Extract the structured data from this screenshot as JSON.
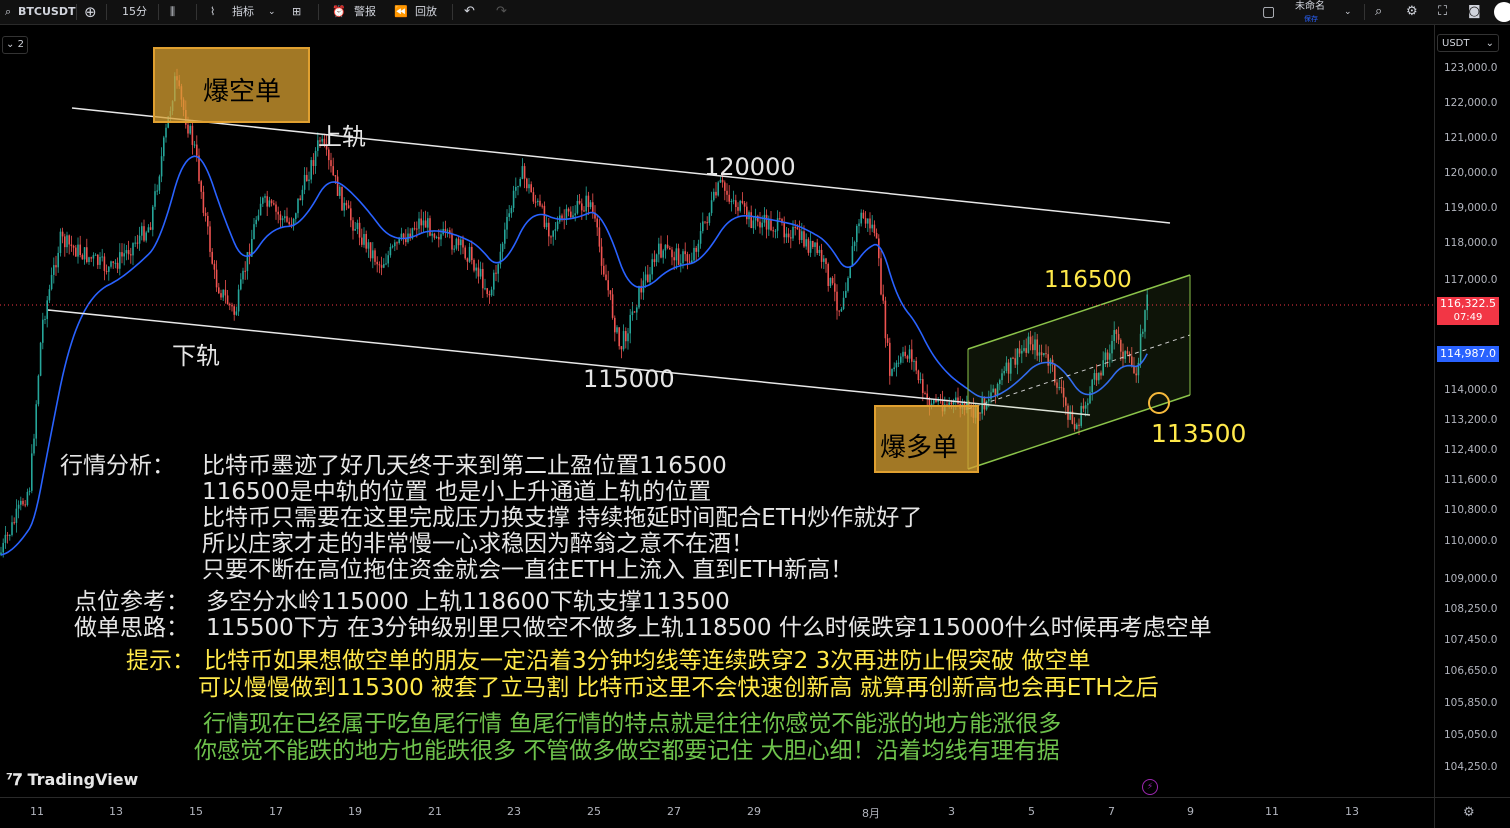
{
  "toolbar": {
    "symbol": "BTCUSDT",
    "interval": "15分",
    "indicators": "指标",
    "alerts": "警报",
    "replay": "回放",
    "layout_name": "未命名",
    "layout_status": "保存",
    "icons": [
      "search-icon",
      "plus-circle-icon",
      "candles-icon",
      "indicators-icon",
      "templates-icon",
      "alert-icon",
      "replay-icon",
      "undo-icon",
      "redo-icon",
      "fullscreen-icon",
      "camera-icon"
    ]
  },
  "legend": {
    "collapse": "2"
  },
  "currency": "USDT",
  "price_axis": [
    "123,000.0",
    "122,000.0",
    "121,000.0",
    "120,000.0",
    "119,000.0",
    "118,000.0",
    "117,000.0",
    "114,000.0",
    "113,200.0",
    "112,400.0",
    "111,600.0",
    "110,800.0",
    "110,000.0",
    "109,000.0",
    "108,250.0",
    "107,450.0",
    "106,650.0",
    "105,850.0",
    "105,050.0",
    "104,250.0"
  ],
  "last_price": {
    "value": "116,322.5",
    "countdown": "07:49",
    "color": "#f23645"
  },
  "ma_price": {
    "value": "114,987.0",
    "color": "#2962ff"
  },
  "time_axis": [
    "11",
    "13",
    "15",
    "17",
    "19",
    "21",
    "23",
    "25",
    "27",
    "29",
    "8月",
    "3",
    "5",
    "7",
    "9",
    "11",
    "13"
  ],
  "annotations": {
    "short_liq": "爆空单",
    "long_liq": "爆多单",
    "upper_rail": "上轨",
    "lower_rail": "下轨",
    "level_120000": "120000",
    "level_115000": "115000",
    "level_116500": "116500",
    "level_113500": "113500"
  },
  "analysis": {
    "label": "行情分析：",
    "lines": [
      "比特币墨迹了好几天终于来到第二止盈位置116500",
      "116500是中轨的位置 也是小上升通道上轨的位置",
      "比特币只需要在这里完成压力换支撑 持续拖延时间配合ETH炒作就好了",
      "所以庄家才走的非常慢一心求稳因为醉翁之意不在酒！",
      "只要不断在高位拖住资金就会一直往ETH上流入 直到ETH新高！"
    ]
  },
  "levels": {
    "label": "点位参考：",
    "text": "多空分水岭115000  上轨118600下轨支撑113500"
  },
  "strategy": {
    "label": "做单思路：",
    "text": "115500下方 在3分钟级别里只做空不做多上轨118500  什么时候跌穿115000什么时候再考虑空单"
  },
  "tip": {
    "label": "提示：",
    "line1": "比特币如果想做空单的朋友一定沿着3分钟均线等连续跌穿2 3次再进防止假突破 做空单",
    "line2": "可以慢慢做到115300 被套了立马割  比特币这里不会快速创新高 就算再创新高也会再ETH之后"
  },
  "note": {
    "line1": "行情现在已经属于吃鱼尾行情 鱼尾行情的特点就是往往你感觉不能涨的地方能涨很多",
    "line2": "你感觉不能跌的地方也能跌很多 不管做多做空都要记住 大胆心细！沿着均线有理有据"
  },
  "brand": "TradingView",
  "colors": {
    "up": "#26a69a",
    "down": "#ef5350",
    "ma": "#2962ff",
    "box": "#d8a032",
    "channel": "#8bc34a",
    "tip": "#ffe94a",
    "note": "#6ec24c"
  }
}
